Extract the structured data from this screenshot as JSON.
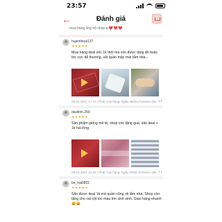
{
  "status_bar": {
    "time": "23:57"
  },
  "header": {
    "title": "Đánh giá"
  },
  "prev_snippet": {
    "text": "mua hàng ủng hộ shop ạ ",
    "hearts": "❤️❤️❤️"
  },
  "reviews": [
    {
      "username": "hujenthoai137",
      "stars": "★★★★★",
      "text": "Mua hàng deal sốc 1k thôi mà còn được tặng đồ buộc tóc cực dễ thương, vải quần mặc mát lắm nha...",
      "photos": [
        {
          "kind": "video",
          "icon": "play-icon"
        },
        {
          "kind": "image"
        },
        {
          "kind": "image"
        }
      ],
      "meta": "06-04-2021 17:37 | Phân loại hàng: Ngẫu Nhiên,Freesize (55-..."
    },
    {
      "username": "davilinh.259",
      "stars": "★★★★★",
      "text": "Sản phẩm giống mô tả, shop còn tặng quà, săn deal + 1k hài lòng",
      "photos": [
        {
          "kind": "video",
          "icon": "play-icon"
        },
        {
          "kind": "image"
        },
        {
          "kind": "image"
        }
      ],
      "meta": "06-04-2021 12:25 | Phân loại hàng: Ngẫu Nhiên,Freesize (55-..."
    },
    {
      "username": "be_hai0801",
      "stars": "★★★★★",
      "text": "Săn được deal 1k mà quần cũng ok lắm nhé. Shop còn tặng cho cái cột tóc màu tím xinh xinh. Giao hàng nhanh 😄😄",
      "photos": [],
      "meta": ""
    }
  ],
  "colors": {
    "accent": "#ee4d2d",
    "star": "#f5a623"
  }
}
